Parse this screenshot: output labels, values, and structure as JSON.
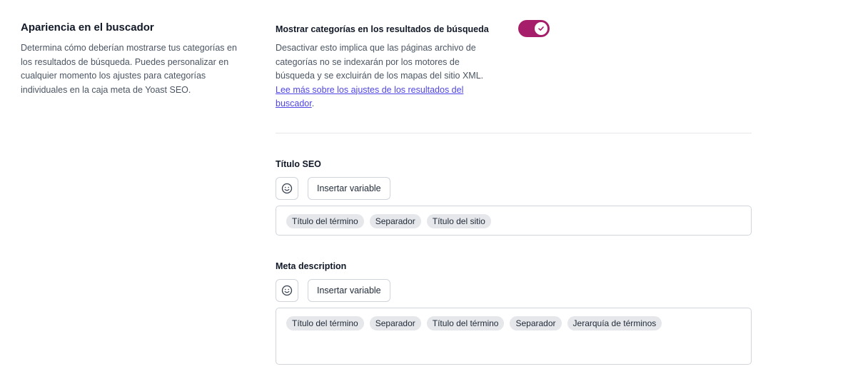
{
  "left": {
    "title": "Apariencia en el buscador",
    "description": "Determina cómo deberían mostrarse tus categorías en los resultados de búsqueda. Puedes personalizar en cualquier momento los ajustes para categorías individuales en la caja meta de Yoast SEO."
  },
  "toggle": {
    "title": "Mostrar categorías en los resultados de búsqueda",
    "description": "Desactivar esto implica que las páginas archivo de categorías no se indexarán por los motores de búsqueda y se excluirán de los mapas del sitio XML. ",
    "link_text": "Lee más sobre los ajustes de los resultados del buscador",
    "after_link": ".",
    "enabled": true,
    "color": "#a61e69"
  },
  "seo_title": {
    "label": "Título SEO",
    "emoji_icon": "smiley-icon",
    "insert_label": "Insertar variable",
    "tags": [
      "Título del término",
      "Separador",
      "Título del sitio"
    ]
  },
  "meta_description": {
    "label": "Meta description",
    "emoji_icon": "smiley-icon",
    "insert_label": "Insertar variable",
    "tags": [
      "Título del término",
      "Separador",
      "Título del término",
      "Separador",
      "Jerarquía de términos"
    ]
  }
}
